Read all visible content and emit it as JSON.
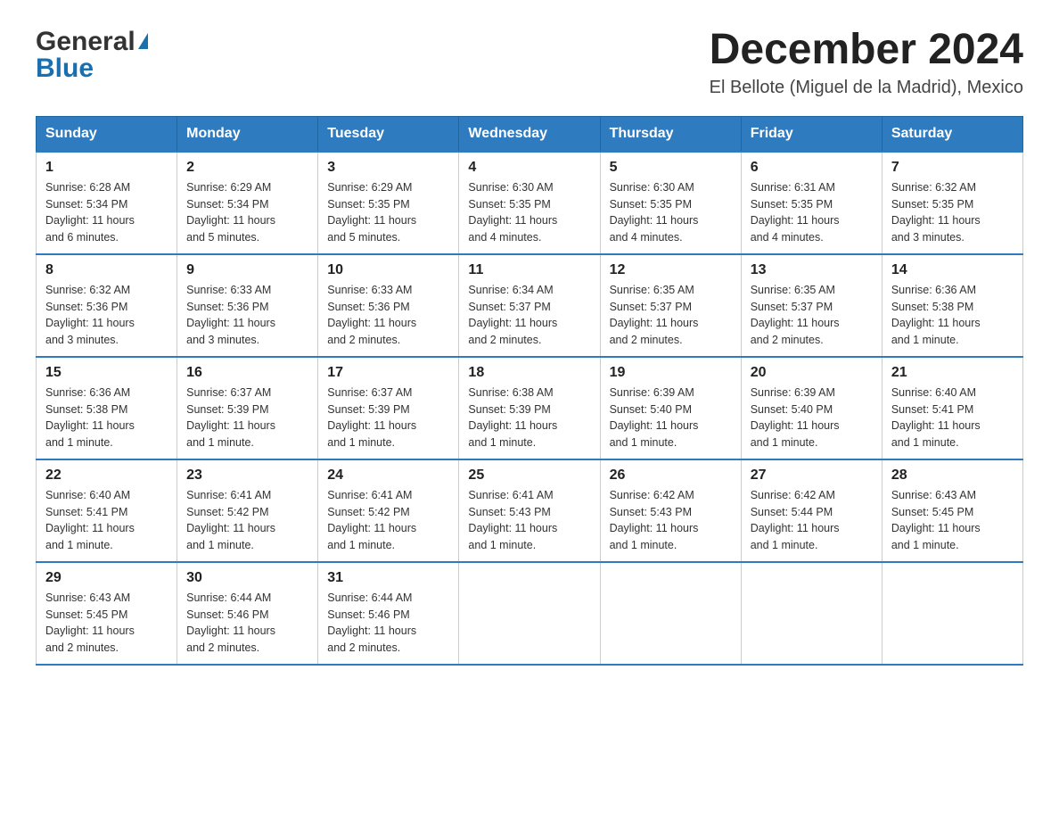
{
  "logo": {
    "general": "General",
    "blue": "Blue"
  },
  "title": {
    "month_year": "December 2024",
    "location": "El Bellote (Miguel de la Madrid), Mexico"
  },
  "weekdays": [
    "Sunday",
    "Monday",
    "Tuesday",
    "Wednesday",
    "Thursday",
    "Friday",
    "Saturday"
  ],
  "weeks": [
    [
      {
        "day": "1",
        "sunrise": "6:28 AM",
        "sunset": "5:34 PM",
        "daylight": "11 hours and 6 minutes."
      },
      {
        "day": "2",
        "sunrise": "6:29 AM",
        "sunset": "5:34 PM",
        "daylight": "11 hours and 5 minutes."
      },
      {
        "day": "3",
        "sunrise": "6:29 AM",
        "sunset": "5:35 PM",
        "daylight": "11 hours and 5 minutes."
      },
      {
        "day": "4",
        "sunrise": "6:30 AM",
        "sunset": "5:35 PM",
        "daylight": "11 hours and 4 minutes."
      },
      {
        "day": "5",
        "sunrise": "6:30 AM",
        "sunset": "5:35 PM",
        "daylight": "11 hours and 4 minutes."
      },
      {
        "day": "6",
        "sunrise": "6:31 AM",
        "sunset": "5:35 PM",
        "daylight": "11 hours and 4 minutes."
      },
      {
        "day": "7",
        "sunrise": "6:32 AM",
        "sunset": "5:35 PM",
        "daylight": "11 hours and 3 minutes."
      }
    ],
    [
      {
        "day": "8",
        "sunrise": "6:32 AM",
        "sunset": "5:36 PM",
        "daylight": "11 hours and 3 minutes."
      },
      {
        "day": "9",
        "sunrise": "6:33 AM",
        "sunset": "5:36 PM",
        "daylight": "11 hours and 3 minutes."
      },
      {
        "day": "10",
        "sunrise": "6:33 AM",
        "sunset": "5:36 PM",
        "daylight": "11 hours and 2 minutes."
      },
      {
        "day": "11",
        "sunrise": "6:34 AM",
        "sunset": "5:37 PM",
        "daylight": "11 hours and 2 minutes."
      },
      {
        "day": "12",
        "sunrise": "6:35 AM",
        "sunset": "5:37 PM",
        "daylight": "11 hours and 2 minutes."
      },
      {
        "day": "13",
        "sunrise": "6:35 AM",
        "sunset": "5:37 PM",
        "daylight": "11 hours and 2 minutes."
      },
      {
        "day": "14",
        "sunrise": "6:36 AM",
        "sunset": "5:38 PM",
        "daylight": "11 hours and 1 minute."
      }
    ],
    [
      {
        "day": "15",
        "sunrise": "6:36 AM",
        "sunset": "5:38 PM",
        "daylight": "11 hours and 1 minute."
      },
      {
        "day": "16",
        "sunrise": "6:37 AM",
        "sunset": "5:39 PM",
        "daylight": "11 hours and 1 minute."
      },
      {
        "day": "17",
        "sunrise": "6:37 AM",
        "sunset": "5:39 PM",
        "daylight": "11 hours and 1 minute."
      },
      {
        "day": "18",
        "sunrise": "6:38 AM",
        "sunset": "5:39 PM",
        "daylight": "11 hours and 1 minute."
      },
      {
        "day": "19",
        "sunrise": "6:39 AM",
        "sunset": "5:40 PM",
        "daylight": "11 hours and 1 minute."
      },
      {
        "day": "20",
        "sunrise": "6:39 AM",
        "sunset": "5:40 PM",
        "daylight": "11 hours and 1 minute."
      },
      {
        "day": "21",
        "sunrise": "6:40 AM",
        "sunset": "5:41 PM",
        "daylight": "11 hours and 1 minute."
      }
    ],
    [
      {
        "day": "22",
        "sunrise": "6:40 AM",
        "sunset": "5:41 PM",
        "daylight": "11 hours and 1 minute."
      },
      {
        "day": "23",
        "sunrise": "6:41 AM",
        "sunset": "5:42 PM",
        "daylight": "11 hours and 1 minute."
      },
      {
        "day": "24",
        "sunrise": "6:41 AM",
        "sunset": "5:42 PM",
        "daylight": "11 hours and 1 minute."
      },
      {
        "day": "25",
        "sunrise": "6:41 AM",
        "sunset": "5:43 PM",
        "daylight": "11 hours and 1 minute."
      },
      {
        "day": "26",
        "sunrise": "6:42 AM",
        "sunset": "5:43 PM",
        "daylight": "11 hours and 1 minute."
      },
      {
        "day": "27",
        "sunrise": "6:42 AM",
        "sunset": "5:44 PM",
        "daylight": "11 hours and 1 minute."
      },
      {
        "day": "28",
        "sunrise": "6:43 AM",
        "sunset": "5:45 PM",
        "daylight": "11 hours and 1 minute."
      }
    ],
    [
      {
        "day": "29",
        "sunrise": "6:43 AM",
        "sunset": "5:45 PM",
        "daylight": "11 hours and 2 minutes."
      },
      {
        "day": "30",
        "sunrise": "6:44 AM",
        "sunset": "5:46 PM",
        "daylight": "11 hours and 2 minutes."
      },
      {
        "day": "31",
        "sunrise": "6:44 AM",
        "sunset": "5:46 PM",
        "daylight": "11 hours and 2 minutes."
      },
      null,
      null,
      null,
      null
    ]
  ],
  "labels": {
    "sunrise": "Sunrise:",
    "sunset": "Sunset:",
    "daylight": "Daylight:"
  }
}
